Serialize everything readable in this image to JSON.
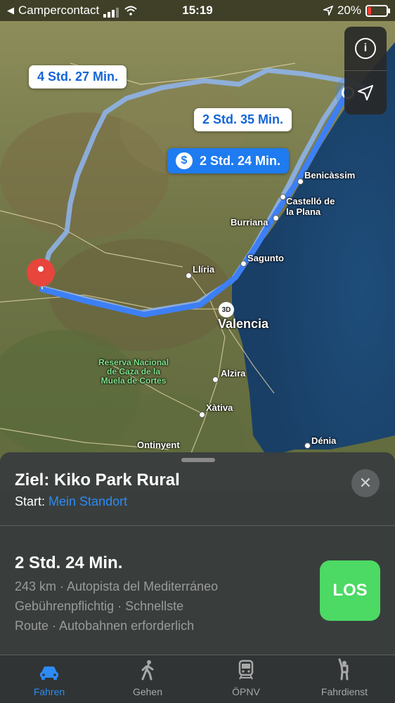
{
  "status_bar": {
    "back_app": "Campercontact",
    "time": "15:19",
    "battery_percent": "20%",
    "battery_level": 0.2
  },
  "map": {
    "route_labels": [
      {
        "text": "4 Std. 27 Min.",
        "selected": false
      },
      {
        "text": "2 Std. 35 Min.",
        "selected": false
      },
      {
        "text": "2 Std. 24 Min.",
        "selected": true,
        "icon": "toll-dollar-icon"
      }
    ],
    "places": [
      {
        "name": "Benicàssim"
      },
      {
        "name": "Castelló de\nla Plana"
      },
      {
        "name": "Burriana"
      },
      {
        "name": "Sagunto"
      },
      {
        "name": "Llíria"
      },
      {
        "name": "Valencia"
      },
      {
        "name": "Alzira"
      },
      {
        "name": "Xàtiva"
      },
      {
        "name": "Ontinyent"
      },
      {
        "name": "Dénia"
      },
      {
        "name": "Reserva Nacional\nde Caza de la\nMuela de Cortes"
      }
    ],
    "badge_3d": "3D",
    "controls": [
      "info-icon",
      "location-arrow-icon"
    ]
  },
  "sheet": {
    "destination_title": "Ziel: Kiko Park Rural",
    "start_label": "Start:",
    "start_value": "Mein Standort",
    "route_time": "2 Std. 24 Min.",
    "route_detail_1": "243 km · Autopista del Mediterráneo",
    "route_detail_2": "Gebührenpflichtig · Schnellste",
    "route_detail_3": "Route · Autobahnen erforderlich",
    "go_label": "LOS"
  },
  "tabs": [
    {
      "label": "Fahren",
      "icon": "car-icon",
      "active": true
    },
    {
      "label": "Gehen",
      "icon": "walk-icon",
      "active": false
    },
    {
      "label": "ÖPNV",
      "icon": "train-icon",
      "active": false
    },
    {
      "label": "Fahrdienst",
      "icon": "hail-icon",
      "active": false
    }
  ],
  "colors": {
    "accent": "#2d8bf5",
    "route": "#3d7ff5",
    "go_button": "#4cd964",
    "pin": "#e8453c"
  }
}
